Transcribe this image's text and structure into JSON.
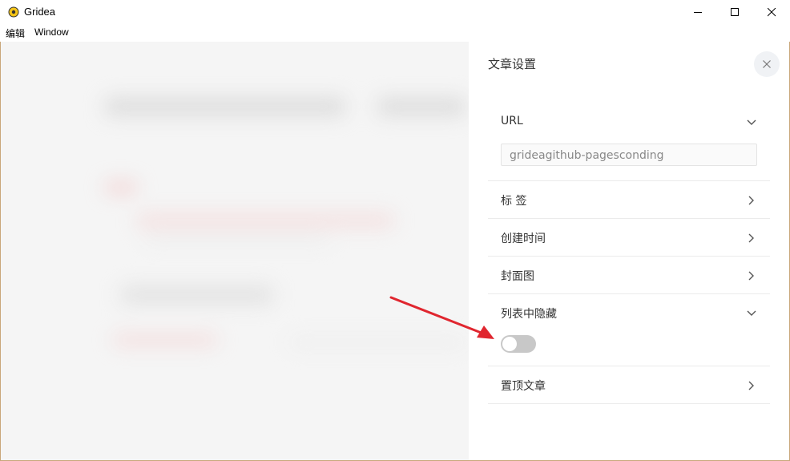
{
  "window": {
    "title": "Gridea",
    "controls": [
      "minimize",
      "maximize",
      "close"
    ]
  },
  "menubar": {
    "items": [
      "编辑",
      "Window"
    ]
  },
  "settings": {
    "title": "文章设置",
    "close_icon": "close-icon",
    "sections": {
      "url": {
        "label": "URL",
        "state": "expanded",
        "value": "grideagithub-pagesconding"
      },
      "tags": {
        "label": "标 签",
        "state": "collapsed"
      },
      "created_time": {
        "label": "创建时间",
        "state": "collapsed"
      },
      "cover": {
        "label": "封面图",
        "state": "collapsed"
      },
      "hide_in_list": {
        "label": "列表中隐藏",
        "state": "expanded",
        "toggle_on": false
      },
      "pin": {
        "label": "置顶文章",
        "state": "collapsed"
      }
    }
  },
  "colors": {
    "toggle_off": "#c8c8c8",
    "annotation_arrow": "#e0262f",
    "window_border": "#c9a77a"
  }
}
